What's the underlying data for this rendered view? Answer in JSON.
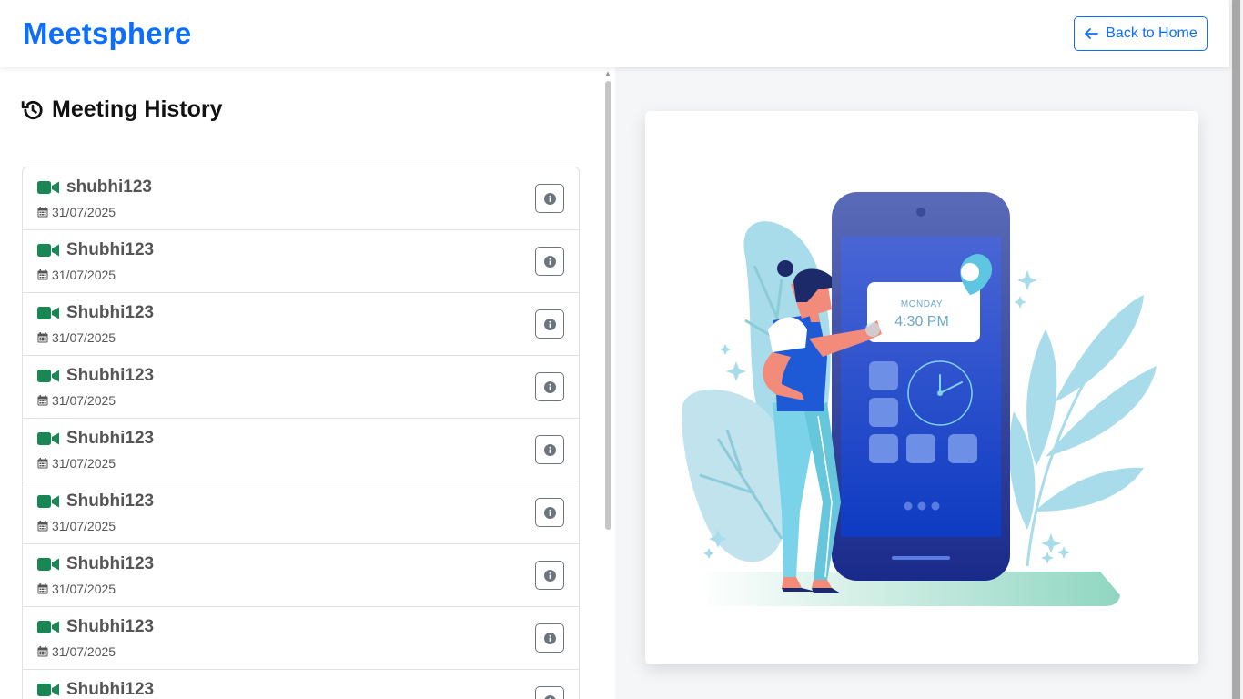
{
  "header": {
    "brand": "Meetsphere",
    "back_label": "Back to Home"
  },
  "history": {
    "title": "Meeting History",
    "items": [
      {
        "name": "shubhi123",
        "date": "31/07/2025"
      },
      {
        "name": "Shubhi123",
        "date": "31/07/2025"
      },
      {
        "name": "Shubhi123",
        "date": "31/07/2025"
      },
      {
        "name": "Shubhi123",
        "date": "31/07/2025"
      },
      {
        "name": "Shubhi123",
        "date": "31/07/2025"
      },
      {
        "name": "Shubhi123",
        "date": "31/07/2025"
      },
      {
        "name": "Shubhi123",
        "date": "31/07/2025"
      },
      {
        "name": "Shubhi123",
        "date": "31/07/2025"
      },
      {
        "name": "Shubhi123",
        "date": ""
      }
    ]
  },
  "illustration": {
    "day": "MONDAY",
    "time": "4:30 PM"
  },
  "icons": {
    "back": "arrow-left-icon",
    "history": "history-icon",
    "meeting": "video-camera-icon",
    "date": "calendar-icon",
    "info": "info-circle-icon"
  },
  "colors": {
    "brand": "#0d6efd",
    "camera": "#198754",
    "text_muted": "#555555",
    "border": "#dee2e6"
  }
}
